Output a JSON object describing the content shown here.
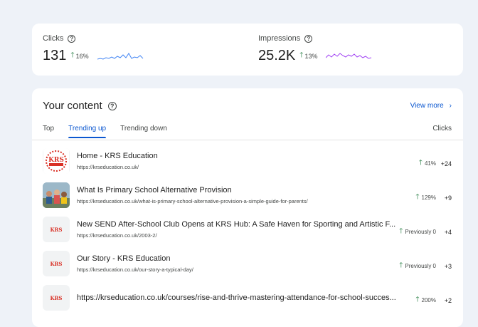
{
  "metrics": {
    "clicks": {
      "label": "Clicks",
      "value": "131",
      "delta": "16%"
    },
    "impressions": {
      "label": "Impressions",
      "value": "25.2K",
      "delta": "13%"
    }
  },
  "content": {
    "title": "Your content",
    "view_more": "View more",
    "tabs": [
      "Top",
      "Trending up",
      "Trending down"
    ],
    "active_tab": "Trending up",
    "column_header": "Clicks",
    "rows": [
      {
        "title": "Home - KRS Education",
        "url": "https://krseducation.co.uk/",
        "change": "41%",
        "clicks": "+24"
      },
      {
        "title": "What Is Primary School Alternative Provision",
        "url": "https://krseducation.co.uk/what-is-primary-school-alternative-provision-a-simple-guide-for-parents/",
        "change": "129%",
        "clicks": "+9"
      },
      {
        "title": "New SEND After-School Club Opens at KRS Hub: A Safe Haven for Sporting and Artistic F...",
        "url": "https://krseducation.co.uk/2003-2/",
        "change": "Previously 0",
        "clicks": "+4"
      },
      {
        "title": "Our Story - KRS Education",
        "url": "https://krseducation.co.uk/our-story-a-typical-day/",
        "change": "Previously 0",
        "clicks": "+3"
      },
      {
        "title": "https://krseducation.co.uk/courses/rise-and-thrive-mastering-attendance-for-school-succes...",
        "url": "",
        "change": "200%",
        "clicks": "+2"
      }
    ]
  },
  "colors": {
    "accent": "#0b57d0",
    "positive": "#137333",
    "clicks_spark": "#4285f4",
    "impressions_spark": "#a142f4"
  }
}
